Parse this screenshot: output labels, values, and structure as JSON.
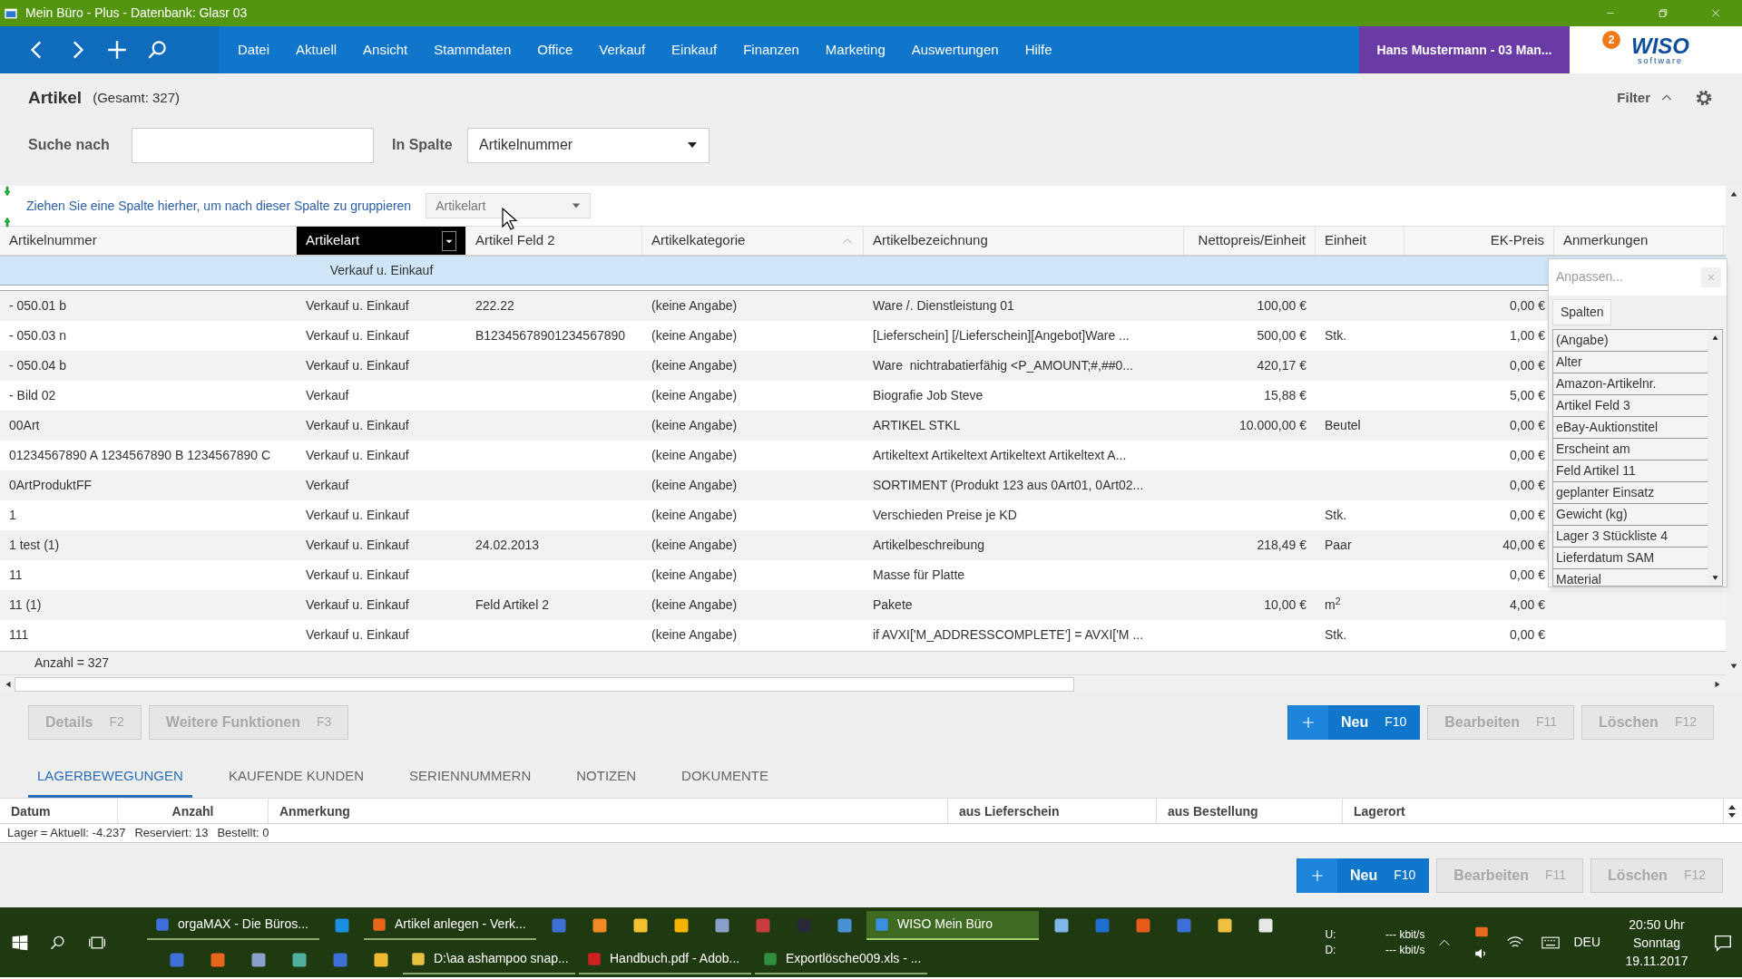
{
  "window": {
    "title": "Mein Büro - Plus - Datenbank: Glasr 03"
  },
  "menu": [
    "Datei",
    "Aktuell",
    "Ansicht",
    "Stammdaten",
    "Office",
    "Verkauf",
    "Einkauf",
    "Finanzen",
    "Marketing",
    "Auswertungen",
    "Hilfe"
  ],
  "user": "Hans Mustermann - 03 Man...",
  "logo": {
    "mark": "2",
    "name": "WISO",
    "sub": "software"
  },
  "page": {
    "title": "Artikel",
    "count": "(Gesamt: 327)",
    "filter": "Filter"
  },
  "search": {
    "label": "Suche nach",
    "column_label": "In Spalte",
    "column_value": "Artikelnummer"
  },
  "group_panel": {
    "hint": "Ziehen Sie eine Spalte hierher, um nach dieser Spalte zu gruppieren",
    "dragged_column": "Artikelart"
  },
  "table": {
    "columns": [
      {
        "label": "Artikelnummer",
        "selected": false,
        "sorted": false
      },
      {
        "label": "Artikelart",
        "selected": true,
        "sorted": false,
        "filter": "Verkauf u. Einkauf"
      },
      {
        "label": "Artikel Feld 2",
        "selected": false,
        "sorted": false
      },
      {
        "label": "Artikelkategorie",
        "selected": false,
        "sorted": true
      },
      {
        "label": "Artikelbezeichnung",
        "selected": false,
        "sorted": false
      },
      {
        "label": "Nettopreis/Einheit",
        "selected": false,
        "sorted": false
      },
      {
        "label": "Einheit",
        "selected": false,
        "sorted": false
      },
      {
        "label": "EK-Preis",
        "selected": false,
        "sorted": false
      },
      {
        "label": "Anmerkungen",
        "selected": false,
        "sorted": false
      }
    ],
    "rows": [
      [
        "- 050.01 b",
        "Verkauf u. Einkauf",
        "222.22",
        "(keine Angabe)",
        "Ware /. Dienstleistung 01",
        "100,00 €",
        null,
        "0,00 €"
      ],
      [
        "- 050.03 n",
        "Verkauf u. Einkauf",
        "B12345678901234567890",
        "(keine Angabe)",
        "[Lieferschein] [/Lieferschein][Angebot]Ware ...",
        "500,00 €",
        "Stk.",
        "1,00 €"
      ],
      [
        "- 050.04 b",
        "Verkauf u. Einkauf",
        null,
        "(keine Angabe)",
        "Ware  nichtrabatierfähig <P_AMOUNT;#,##0...",
        "420,17 €",
        null,
        "0,00 €"
      ],
      [
        "- Bild 02",
        "Verkauf",
        null,
        "(keine Angabe)",
        "Biografie Job Steve",
        "15,88 €",
        null,
        "5,00 €"
      ],
      [
        "00Art",
        "Verkauf u. Einkauf",
        null,
        "(keine Angabe)",
        "ARTIKEL STKL",
        "10.000,00 €",
        "Beutel",
        "0,00 €"
      ],
      [
        "01234567890 A 1234567890 B 1234567890 C",
        "Verkauf u. Einkauf",
        null,
        "(keine Angabe)",
        "Artikeltext Artikeltext Artikeltext Artikeltext A...",
        null,
        null,
        "0,00 €"
      ],
      [
        "0ArtProduktFF",
        "Verkauf",
        null,
        "(keine Angabe)",
        "SORTIMENT (Produkt 123 aus 0Art01, 0Art02...",
        null,
        null,
        "0,00 €"
      ],
      [
        "1",
        "Verkauf u. Einkauf",
        null,
        "(keine Angabe)",
        "Verschieden Preise je KD",
        null,
        "Stk.",
        "0,00 €"
      ],
      [
        "1 test (1)",
        "Verkauf u. Einkauf",
        "24.02.2013",
        "(keine Angabe)",
        "Artikelbeschreibung",
        "218,49 €",
        "Paar",
        "40,00 €"
      ],
      [
        "11",
        "Verkauf u. Einkauf",
        null,
        "(keine Angabe)",
        "Masse für Platte",
        null,
        null,
        "0,00 €"
      ],
      [
        "11 (1)",
        "Verkauf u. Einkauf",
        "Feld Artikel 2",
        "(keine Angabe)",
        "Pakete",
        "10,00 €",
        "m$^{2}$",
        "4,00 €"
      ],
      [
        "111",
        "Verkauf u. Einkauf",
        null,
        "(keine Angabe)",
        "if AVXI['M_ADDRESSCOMPLETE'] = AVXI['M ...",
        null,
        "Stk.",
        "0,00 €"
      ]
    ],
    "footer": "Anzahl = 327"
  },
  "customize": {
    "placeholder": "Anpassen...",
    "close": "×",
    "tab": "Spalten",
    "items": [
      "(Angabe)",
      "Alter",
      "Amazon-Artikelnr.",
      "Artikel Feld 3",
      "eBay-Auktionstitel",
      "Erscheint am",
      "Feld Artikel 11",
      "geplanter Einsatz",
      "Gewicht (kg)",
      "Lager 3 Stückliste 4",
      "Lieferdatum SAM",
      "Material"
    ]
  },
  "actions_left": [
    {
      "label": "Details",
      "key": "F2",
      "disabled": true
    },
    {
      "label": "Weitere Funktionen",
      "key": "F3",
      "disabled": true
    }
  ],
  "actions_right": [
    {
      "kind": "primary",
      "label": "Neu",
      "key": "F10",
      "disabled": false
    },
    {
      "kind": "plain",
      "label": "Bearbeiten",
      "key": "F11",
      "disabled": true
    },
    {
      "kind": "plain",
      "label": "Löschen",
      "key": "F12",
      "disabled": true
    }
  ],
  "detail_tabs": [
    {
      "label": "LAGERBEWEGUNGEN",
      "selected": true
    },
    {
      "label": "KAUFENDE KUNDEN",
      "selected": false
    },
    {
      "label": "SERIENNUMMERN",
      "selected": false
    },
    {
      "label": "NOTIZEN",
      "selected": false
    },
    {
      "label": "DOKUMENTE",
      "selected": false
    }
  ],
  "detail_table": {
    "columns": [
      "Datum",
      "Anzahl",
      "Anmerkung",
      "aus Lieferschein",
      "aus Bestellung",
      "Lagerort"
    ]
  },
  "stock_status": [
    "Lager = Aktuell: -4.237",
    "Reserviert: 13",
    "Bestellt: 0"
  ],
  "actions_bottom": [
    {
      "kind": "primary",
      "label": "Neu",
      "key": "F10",
      "disabled": false
    },
    {
      "kind": "plain",
      "label": "Bearbeiten",
      "key": "F11",
      "disabled": true
    },
    {
      "kind": "plain",
      "label": "Löschen",
      "key": "F12",
      "disabled": true
    }
  ],
  "taskbar": {
    "rows": [
      [
        {
          "label": "orgaMAX - Die Büros...",
          "color": "#3d6fd6",
          "selected": false
        },
        {
          "color": "#1a8fe3"
        },
        {
          "label": "Artikel anlegen - Verk...",
          "color": "#e8661c",
          "selected": false
        },
        {
          "color": "#3d6fd6"
        },
        {
          "color": "#f08a24"
        },
        {
          "color": "#f2c230"
        },
        {
          "color": "#f5b400"
        },
        {
          "color": "#8aa0c8"
        },
        {
          "color": "#c83c3c"
        },
        {
          "color": "#2a2a3a"
        },
        {
          "color": "#4a90d6"
        },
        {
          "label": "WISO Mein Büro",
          "color": "#3b8fe0",
          "selected": true
        },
        {
          "color": "#7fb8e8"
        },
        {
          "color": "#1e6fd0"
        },
        {
          "color": "#e85a1c"
        },
        {
          "color": "#3d6fd6"
        },
        {
          "color": "#f0c040"
        },
        {
          "color": "#e8e8e8"
        }
      ],
      [
        {
          "color": "#3d6fd6"
        },
        {
          "color": "#e8661c"
        },
        {
          "color": "#8aa0c8"
        },
        {
          "color": "#4fb0a0"
        },
        {
          "color": "#3d6fd6"
        },
        {
          "color": "#f0b830"
        },
        {
          "label": "D:\\aa ashampoo snap...",
          "color": "#e8c040",
          "selected": false
        },
        {
          "label": "Handbuch.pdf - Adob...",
          "color": "#d02020",
          "selected": false
        },
        {
          "label": "Exportlösche009.xls - ...",
          "color": "#2f8f3f",
          "selected": false
        }
      ]
    ],
    "net": [
      {
        "dir": "U:",
        "rate": "--- kbit/s"
      },
      {
        "dir": "D:",
        "rate": "--- kbit/s"
      }
    ],
    "language": "DEU",
    "time": "20:50 Uhr",
    "day": "Sonntag",
    "date": "19.11.2017"
  }
}
